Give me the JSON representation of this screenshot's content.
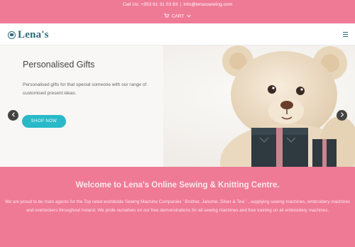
{
  "topbar": {
    "phone": "Call Us: +353 61 31 03 83",
    "separator": "|",
    "email": "info@lenassewing.com",
    "cart_icon": "cart-icon",
    "cart_label": "CART",
    "chevron_icon": "chevron-down-icon"
  },
  "navbar": {
    "logo_text": "Lena's",
    "menu_icon": "hamburger-icon"
  },
  "hero": {
    "title": "Personalised Gifts",
    "text": "Personalised gifts for that special someone with our range of customised present ideas.",
    "button_label": "SHOP NOW",
    "prev_icon": "chevron-left-icon",
    "next_icon": "chevron-right-icon"
  },
  "welcome": {
    "title": "Welcome to Lena's Online Sewing & Knitting Centre.",
    "text": "We are proud to be main agents for the Top rated worldwide Sewing Machine Companies ' Brother, Janome, Silver & Texi ' , supplying sewing machines, embroidery machines and overlockers throughout Ireland. We pride ourselves on our free demonstrations for all sewing machines and free training on all embroidery machines."
  },
  "colors": {
    "brand_pink": "#ef7a96",
    "accent_teal": "#29b9c8",
    "logo_teal": "#2d6a7b"
  }
}
